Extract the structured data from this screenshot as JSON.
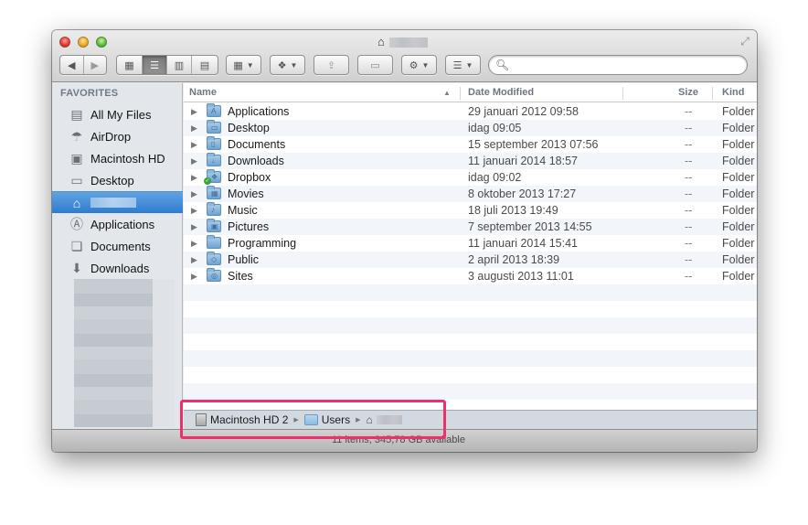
{
  "window": {
    "title_icon": "home-icon",
    "title_redacted": true
  },
  "toolbar": {
    "back_icon": "◀",
    "forward_icon": "▶",
    "view_icon_glyph": "▦",
    "view_list_glyph": "☰",
    "view_columns_glyph": "▥",
    "view_coverflow_glyph": "▤",
    "arrange_glyph": "▦",
    "dropbox_glyph": "❖",
    "share_glyph": "⇪",
    "tags_glyph": "▭",
    "action_glyph": "⚙",
    "sort_glyph": "☰",
    "caret": "▼",
    "active_view": "list",
    "search_placeholder": "",
    "search_value": ""
  },
  "sidebar": {
    "heading": "FAVORITES",
    "items": [
      {
        "label": "All My Files",
        "icon": "all-my-files-icon",
        "glyph": "▤"
      },
      {
        "label": "AirDrop",
        "icon": "airdrop-icon",
        "glyph": "☂"
      },
      {
        "label": "Macintosh HD",
        "icon": "hard-drive-icon",
        "glyph": "▣"
      },
      {
        "label": "Desktop",
        "icon": "desktop-icon",
        "glyph": "▭"
      },
      {
        "label": "",
        "icon": "home-icon",
        "glyph": "⌂",
        "selected": true,
        "redacted": true
      },
      {
        "label": "Applications",
        "icon": "applications-icon",
        "glyph": "Ⓐ"
      },
      {
        "label": "Documents",
        "icon": "documents-icon",
        "glyph": "❏"
      },
      {
        "label": "Downloads",
        "icon": "downloads-icon",
        "glyph": "⬇"
      }
    ]
  },
  "list": {
    "columns": {
      "name": "Name",
      "date": "Date Modified",
      "size": "Size",
      "kind": "Kind",
      "sort_indicator": "▲"
    },
    "rows": [
      {
        "name": "Applications",
        "date": "29 januari 2012 09:58",
        "size": "--",
        "kind": "Folder",
        "glyph": "A"
      },
      {
        "name": "Desktop",
        "date": "idag 09:05",
        "size": "--",
        "kind": "Folder",
        "glyph": "▭"
      },
      {
        "name": "Documents",
        "date": "15 september 2013 07:56",
        "size": "--",
        "kind": "Folder",
        "glyph": "▯"
      },
      {
        "name": "Downloads",
        "date": "11 januari 2014 18:57",
        "size": "--",
        "kind": "Folder",
        "glyph": "↓"
      },
      {
        "name": "Dropbox",
        "date": "idag 09:02",
        "size": "--",
        "kind": "Folder",
        "glyph": "❖",
        "synced": true
      },
      {
        "name": "Movies",
        "date": "8 oktober 2013 17:27",
        "size": "--",
        "kind": "Folder",
        "glyph": "▦"
      },
      {
        "name": "Music",
        "date": "18 juli 2013 19:49",
        "size": "--",
        "kind": "Folder",
        "glyph": "♪"
      },
      {
        "name": "Pictures",
        "date": "7 september 2013 14:55",
        "size": "--",
        "kind": "Folder",
        "glyph": "▣"
      },
      {
        "name": "Programming",
        "date": "11 januari 2014 15:41",
        "size": "--",
        "kind": "Folder",
        "glyph": ""
      },
      {
        "name": "Public",
        "date": "2 april 2013 18:39",
        "size": "--",
        "kind": "Folder",
        "glyph": "◇"
      },
      {
        "name": "Sites",
        "date": "3 augusti 2013 11:01",
        "size": "--",
        "kind": "Folder",
        "glyph": "◎"
      }
    ],
    "empty_rows": 7
  },
  "pathbar": {
    "items": [
      {
        "label": "Macintosh HD 2",
        "icon": "hard-drive-icon"
      },
      {
        "label": "Users",
        "icon": "folder-icon"
      },
      {
        "label": "",
        "icon": "home-icon",
        "redacted": true
      }
    ],
    "separator": "▶"
  },
  "status": {
    "text": "11 items, 345,78 GB available"
  },
  "annotation": {
    "highlight_color": "#ee2f6b"
  }
}
